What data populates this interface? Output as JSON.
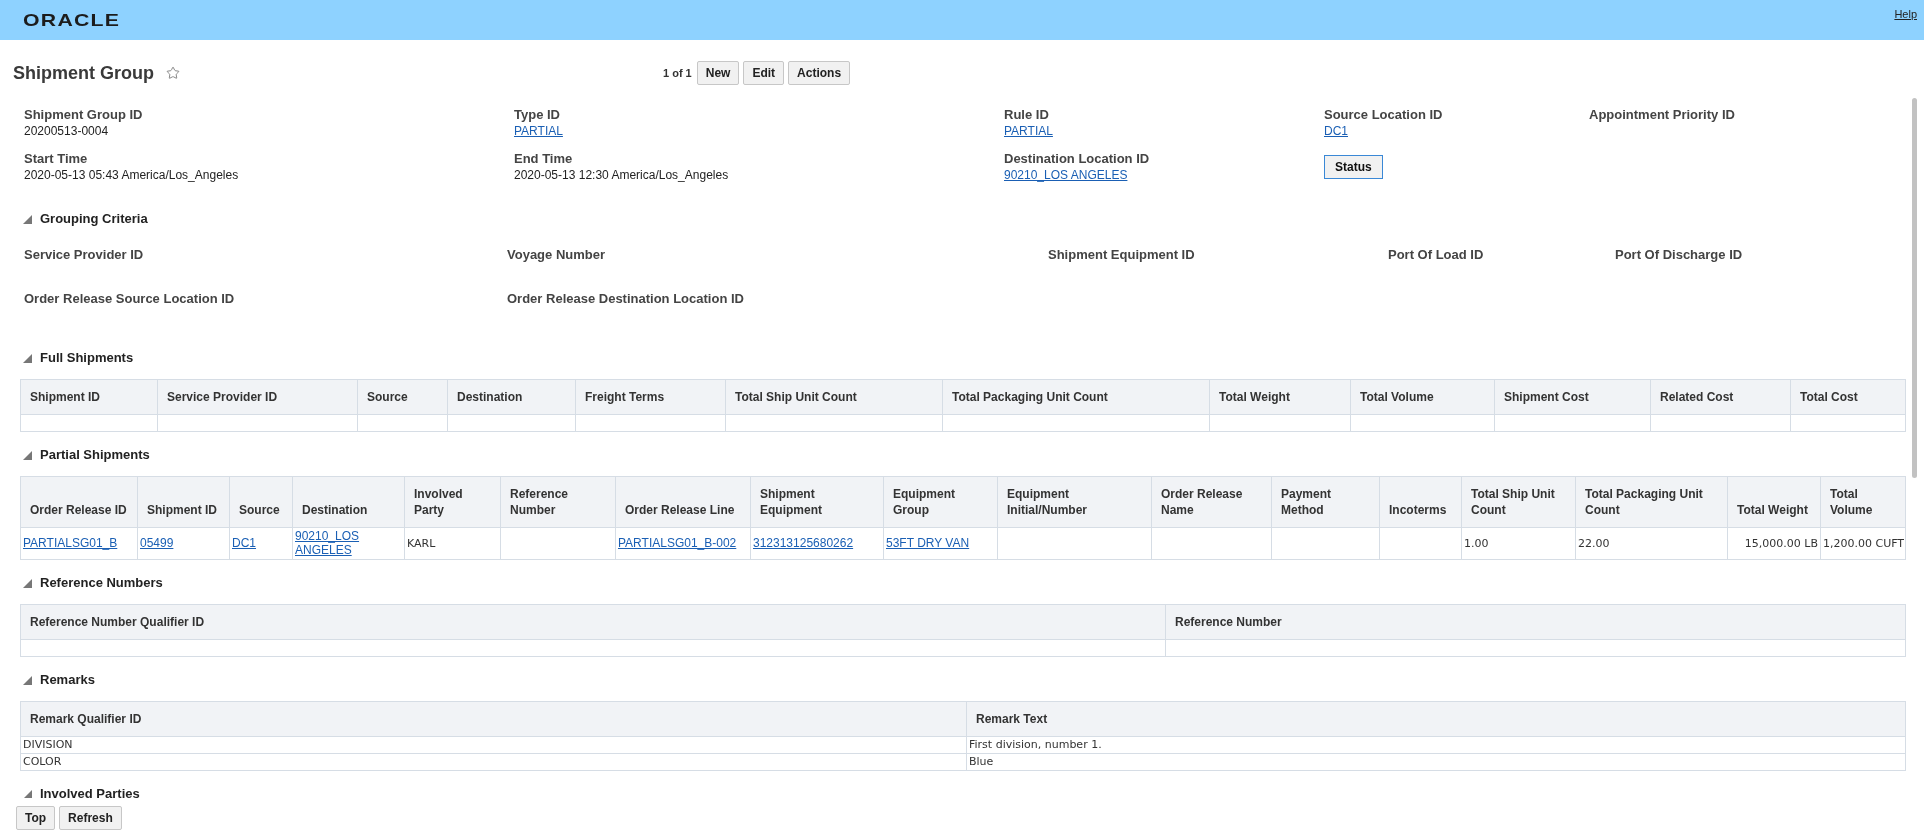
{
  "header": {
    "logo": "ORACLE",
    "help": "Help"
  },
  "page": {
    "title": "Shipment Group",
    "pager": "1 of 1",
    "buttons": [
      "New",
      "Edit",
      "Actions"
    ]
  },
  "details": [
    {
      "kind": "field",
      "label": "Shipment Group ID",
      "value": "20200513-0004",
      "link": false
    },
    {
      "kind": "field",
      "label": "Type ID",
      "value": "PARTIAL",
      "link": true
    },
    {
      "kind": "field",
      "label": "Rule ID",
      "value": "PARTIAL",
      "link": true
    },
    {
      "kind": "field",
      "label": "Source Location ID",
      "value": "DC1",
      "link": true
    },
    {
      "kind": "field",
      "label": "Appointment Priority ID"
    },
    {
      "kind": "field",
      "label": "Start Time",
      "value": "2020-05-13 05:43 America/Los_Angeles",
      "link": false
    },
    {
      "kind": "field",
      "label": "End Time",
      "value": "2020-05-13 12:30 America/Los_Angeles",
      "link": false
    },
    {
      "kind": "field",
      "label": "Destination Location ID",
      "value": "90210_LOS ANGELES",
      "link": true
    },
    {
      "kind": "button",
      "label": "Status"
    }
  ],
  "grouping": {
    "title": "Grouping Criteria",
    "expanded": true,
    "fields": [
      "Service Provider ID",
      "Voyage Number",
      "Shipment Equipment ID",
      "Port Of Load ID",
      "Port Of Discharge ID",
      "Order Release Source Location ID",
      "Order Release Destination Location ID"
    ]
  },
  "tables": [
    {
      "title": "Full Shipments",
      "expanded": true,
      "columns": [
        "Shipment ID",
        "Service Provider ID",
        "Source",
        "Destination",
        "Freight Terms",
        "Total Ship Unit Count",
        "Total Packaging Unit Count",
        "Total Weight",
        "Total Volume",
        "Shipment Cost",
        "Related Cost",
        "Total Cost"
      ]
    },
    {
      "title": "Partial Shipments",
      "expanded": true,
      "columns": [
        "Order Release ID",
        "Shipment ID",
        "Source",
        "Destination",
        "Involved Party",
        "Reference Number",
        "Order Release Line",
        "Shipment Equipment",
        "Equipment Group",
        "Equipment Initial/Number",
        "Order Release Name",
        "Payment Method",
        "Incoterms",
        "Total Ship Unit Count",
        "Total Packaging Unit Count",
        "Total Weight",
        "Total Volume"
      ],
      "rows": [
        [
          {
            "text": "PARTIALSG01_B",
            "link": true
          },
          {
            "text": "05499",
            "link": true
          },
          {
            "text": "DC1",
            "link": true
          },
          {
            "text": "90210_LOS ANGELES",
            "link": true
          },
          {
            "text": "KARL",
            "link": false
          },
          null,
          {
            "text": "PARTIALSG01_B-002",
            "link": true
          },
          {
            "text": "312313125680262",
            "link": true
          },
          {
            "text": "53FT DRY VAN",
            "link": true
          },
          null,
          null,
          null,
          null,
          {
            "text": "1.00",
            "link": false
          },
          {
            "text": "22.00",
            "link": false
          },
          {
            "text": "15,000.00 LB",
            "link": false
          },
          {
            "text": "1,200.00 CUFT",
            "link": false
          }
        ]
      ]
    },
    {
      "title": "Reference Numbers",
      "expanded": true,
      "columns": [
        "Reference Number Qualifier ID",
        "Reference Number"
      ]
    },
    {
      "title": "Remarks",
      "expanded": true,
      "columns": [
        "Remark Qualifier ID",
        "Remark Text"
      ],
      "rows": [
        [
          {
            "text": "DIVISION",
            "link": false
          },
          {
            "text": "First division, number 1.",
            "link": false
          }
        ],
        [
          {
            "text": "COLOR",
            "link": false
          },
          {
            "text": "Blue",
            "link": false
          }
        ]
      ]
    },
    {
      "title": "Involved Parties",
      "expanded": true
    }
  ],
  "footer": {
    "buttons": [
      "Top",
      "Refresh"
    ]
  }
}
